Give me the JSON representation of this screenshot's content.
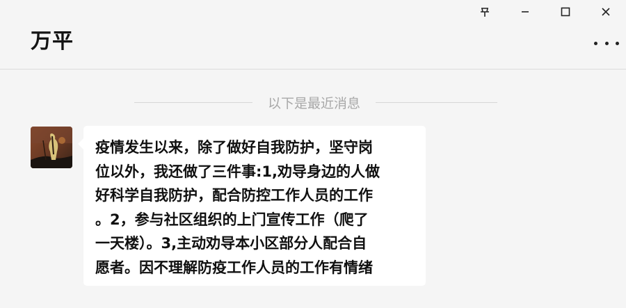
{
  "window": {
    "title": "万平",
    "controls": [
      "pin-icon",
      "minimize-icon",
      "maximize-icon",
      "close-icon"
    ]
  },
  "chat": {
    "divider_text": "以下是最近消息",
    "messages": [
      {
        "sender_avatar": "avatar",
        "lines": [
          "疫情发生以来，除了做好自我防护，坚守岗",
          "位以外，我还做了三件事:1,劝导身边的人做",
          "好科学自我防护，配合防控工作人员的工作",
          "。2，参与社区组织的上门宣传工作（爬了",
          "一天楼）。3,主动劝导本小区部分人配合自",
          "愿者。因不理解防疫工作人员的工作有情绪"
        ]
      }
    ]
  },
  "colors": {
    "background": "#f5f5f5",
    "bubble": "#ffffff",
    "divider_text": "#a8a8a8"
  }
}
